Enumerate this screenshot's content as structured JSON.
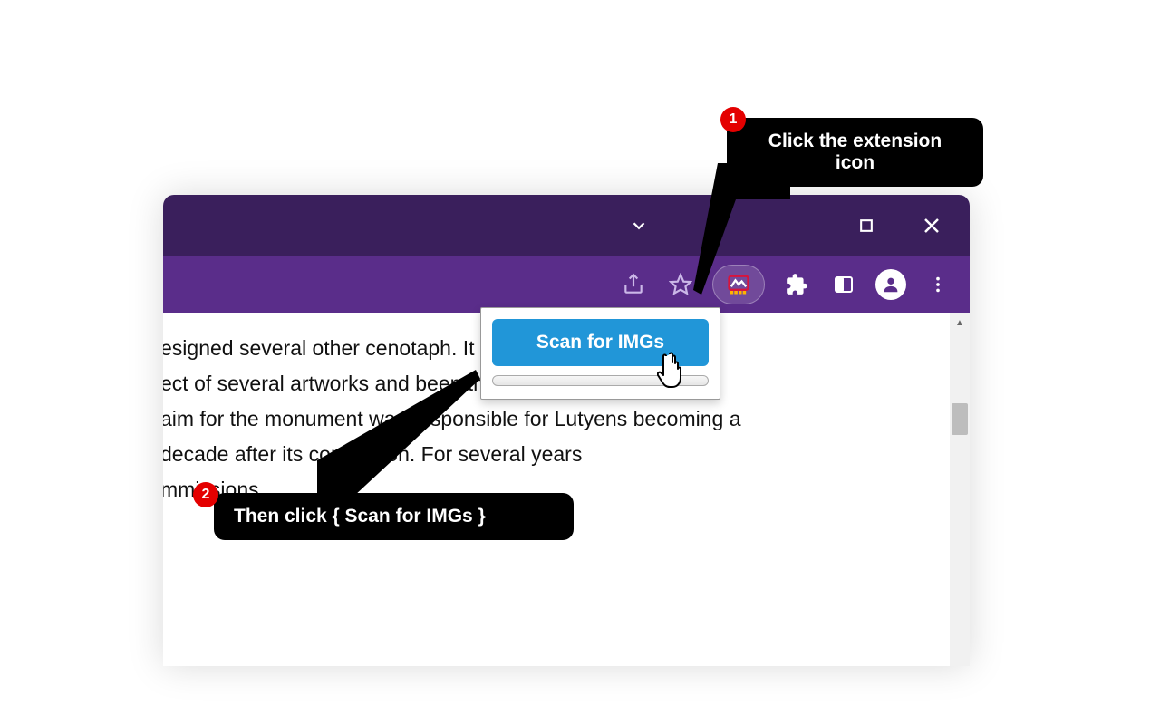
{
  "titlebar": {
    "dropdown_icon": "chevron-down",
    "restore_icon": "square",
    "close_icon": "x"
  },
  "toolbar": {
    "share_icon": "share",
    "star_icon": "star",
    "extension_icon": "image-scan",
    "extensions_menu_icon": "puzzle",
    "sidepanel_icon": "panel",
    "profile_icon": "avatar",
    "menu_icon": "dots-vertical"
  },
  "popup": {
    "button_label": "Scan for IMGs"
  },
  "content": {
    "text": "esigned several other cenotaph. It has featured common\nect of several artworks and been the notable works of\naim for the monument was responsible for Lutyens becoming a\ndecade after its completion. For several years\nmmissions."
  },
  "callouts": {
    "step1_number": "1",
    "step1_text": "Click the extension icon",
    "step2_number": "2",
    "step2_text": "Then click { Scan for IMGs }"
  }
}
